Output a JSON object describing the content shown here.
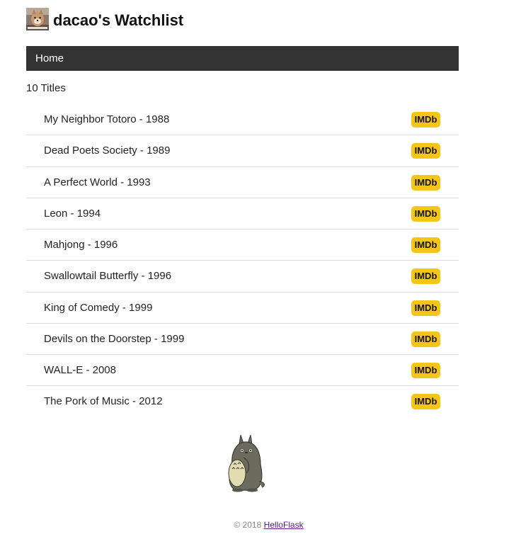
{
  "header": {
    "title": "dacao's Watchlist"
  },
  "nav": {
    "home_label": "Home"
  },
  "count": "10 Titles",
  "movies": [
    {
      "title": "My Neighbor Totoro - 1988",
      "badge": "IMDb"
    },
    {
      "title": "Dead Poets Society - 1989",
      "badge": "IMDb"
    },
    {
      "title": "A Perfect World - 1993",
      "badge": "IMDb"
    },
    {
      "title": "Leon - 1994",
      "badge": "IMDb"
    },
    {
      "title": "Mahjong - 1996",
      "badge": "IMDb"
    },
    {
      "title": "Swallowtail Butterfly - 1996",
      "badge": "IMDb"
    },
    {
      "title": "King of Comedy - 1999",
      "badge": "IMDb"
    },
    {
      "title": "Devils on the Doorstep - 1999",
      "badge": "IMDb"
    },
    {
      "title": "WALL-E - 2008",
      "badge": "IMDb"
    },
    {
      "title": "The Pork of Music - 2012",
      "badge": "IMDb"
    }
  ],
  "footer": {
    "copyright": "© 2018",
    "link_label": "HelloFlask"
  },
  "colors": {
    "navbar": "#333333",
    "imdb_badge": "#f5c518",
    "divider": "#dddddd",
    "footer_link": "#551a8b"
  },
  "icons": {
    "avatar": "avatar-image",
    "mascot": "totoro-image"
  }
}
